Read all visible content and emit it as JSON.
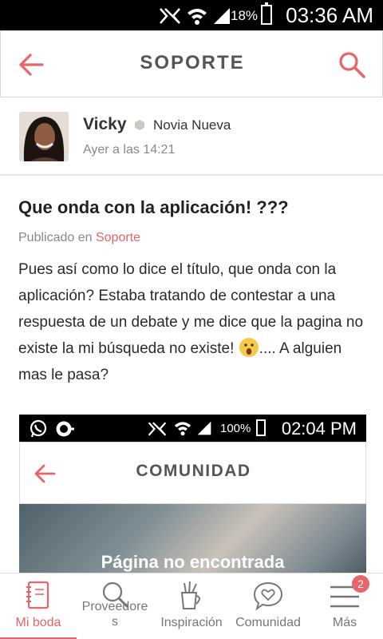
{
  "status_bar": {
    "battery": "18%",
    "time": "03:36 AM",
    "icons": [
      "nfc-icon",
      "wifi-icon",
      "signal-icon",
      "battery-icon"
    ]
  },
  "app_bar": {
    "title": "SOPORTE",
    "back_icon": "arrow-left-icon",
    "search_icon": "search-icon"
  },
  "author": {
    "name": "Vicky",
    "rank": "Novia Nueva",
    "time": "Ayer a las 14:21"
  },
  "post": {
    "title": "Que onda con la aplicación! ???",
    "published_prefix": "Publicado en",
    "category": "Soporte",
    "body_text": "Pues así como lo dice el título, que onda con la aplicación? Estaba tratando de contestar a una respuesta de un debate y me dice que la pagina no existe la mi búsqueda no existe! ",
    "body_emoji": "astonished-face-emoji",
    "body_tail": ".... A alguien mas le pasa?"
  },
  "embedded_screenshot": {
    "battery": "100%",
    "time": "02:04 PM",
    "title": "COMUNIDAD",
    "message": "Página no encontrada"
  },
  "bottom_nav": {
    "items": [
      {
        "label": "Mi boda",
        "icon": "notebook-icon",
        "active": true
      },
      {
        "label": "Proveedore\ns",
        "icon": "search-icon",
        "active": false
      },
      {
        "label": "Inspiración",
        "icon": "tools-cup-icon",
        "active": false
      },
      {
        "label": "Comunidad",
        "icon": "heart-chat-icon",
        "active": false
      },
      {
        "label": "Más",
        "icon": "menu-icon",
        "active": false,
        "badge": "2"
      }
    ]
  },
  "colors": {
    "accent": "#e8636a",
    "text": "#2b2b2b",
    "muted": "#888888"
  }
}
